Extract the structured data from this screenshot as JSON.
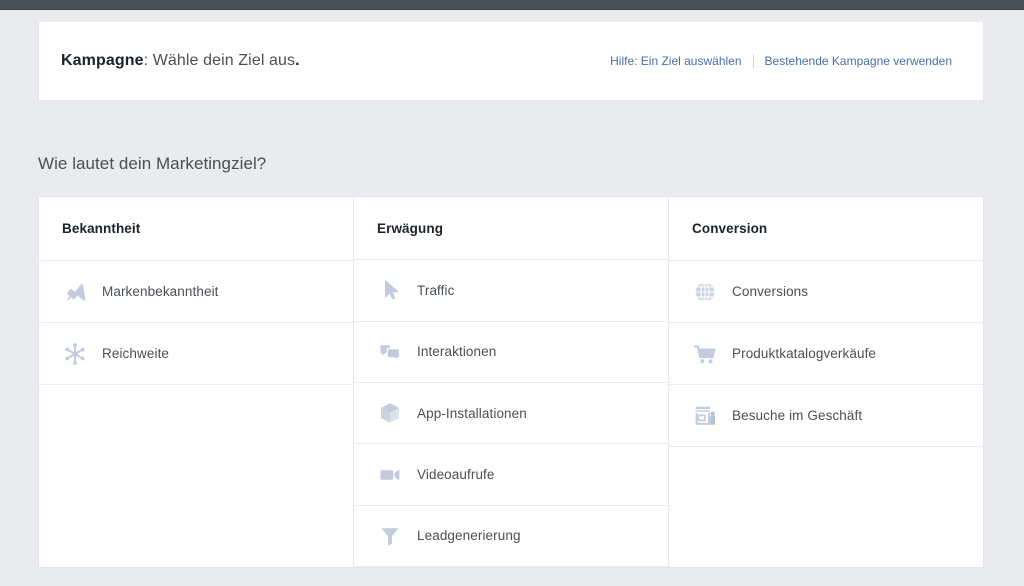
{
  "header": {
    "title_strong": "Kampagne",
    "title_rest": ": Wähle dein Ziel aus",
    "title_dot": ".",
    "links": [
      {
        "label": "Hilfe: Ein Ziel auswählen"
      },
      {
        "label": "Bestehende Kampagne verwenden"
      }
    ]
  },
  "section": {
    "question": "Wie lautet dein Marketingziel?"
  },
  "colors": {
    "page_background": "#e9ebee",
    "card_background": "#ffffff",
    "topbar": "#4b4f56",
    "link": "#4b6ea9",
    "text_primary": "#1d2129",
    "text_secondary": "#4b4f56",
    "icon": "#c3cbdc",
    "border": "#e8eaed"
  },
  "table": {
    "columns": [
      {
        "header": "Bekanntheit",
        "items": [
          {
            "label": "Markenbekanntheit",
            "icon": "megaphone-icon"
          },
          {
            "label": "Reichweite",
            "icon": "reach-starburst-icon"
          }
        ]
      },
      {
        "header": "Erwägung",
        "items": [
          {
            "label": "Traffic",
            "icon": "cursor-arrow-icon"
          },
          {
            "label": "Interaktionen",
            "icon": "speech-bubbles-icon"
          },
          {
            "label": "App-Installationen",
            "icon": "cube-box-icon"
          },
          {
            "label": "Videoaufrufe",
            "icon": "video-camera-icon"
          },
          {
            "label": "Leadgenerierung",
            "icon": "funnel-icon"
          }
        ]
      },
      {
        "header": "Conversion",
        "items": [
          {
            "label": "Conversions",
            "icon": "globe-icon"
          },
          {
            "label": "Produktkatalogverkäufe",
            "icon": "shopping-cart-icon"
          },
          {
            "label": "Besuche im Geschäft",
            "icon": "storefront-icon"
          }
        ]
      }
    ]
  }
}
